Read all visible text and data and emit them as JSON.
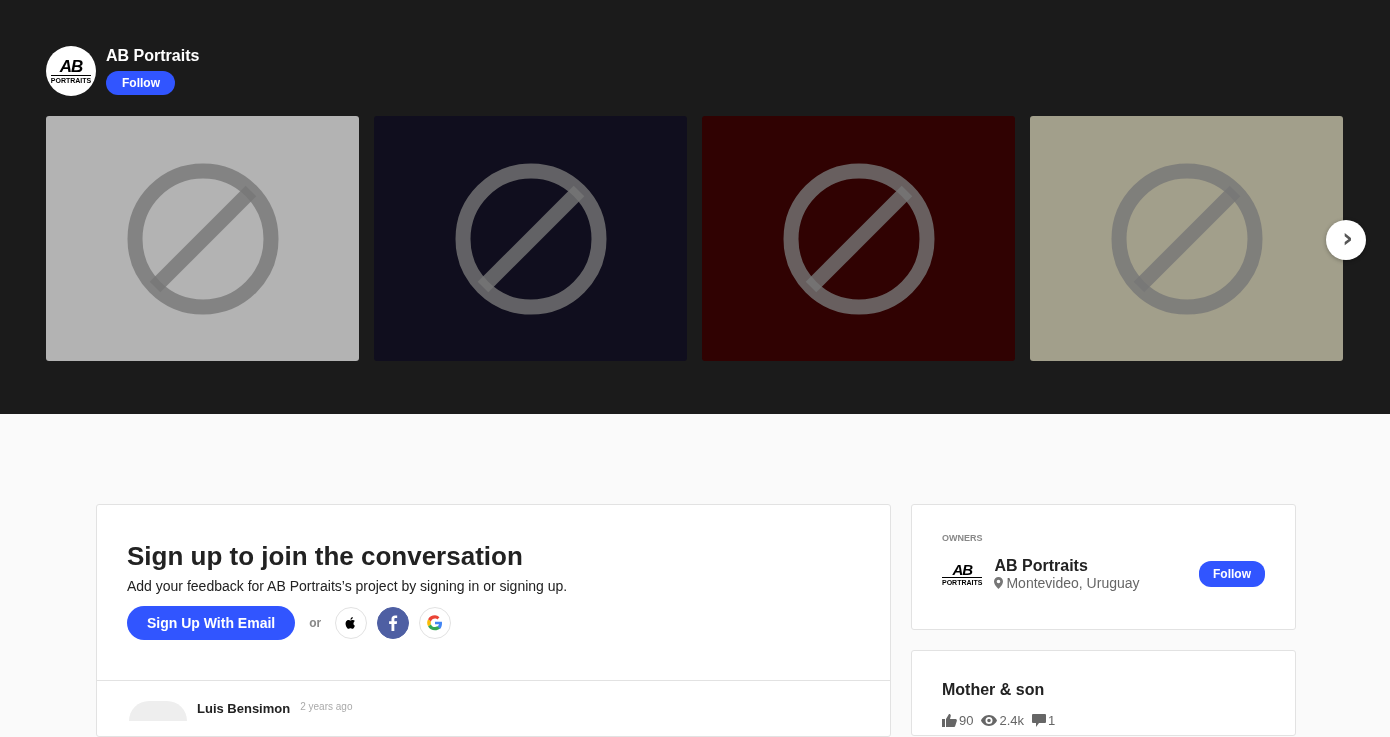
{
  "header": {
    "logo": {
      "mark": "AB",
      "caption": "PORTRAITS"
    },
    "name": "AB Portraits",
    "follow": "Follow"
  },
  "gallery": {
    "images": [
      {
        "color": "#b3b3b3"
      },
      {
        "color": "#100e1e"
      },
      {
        "color": "#300202"
      },
      {
        "color": "#a29f8b"
      }
    ],
    "next": "›"
  },
  "signup": {
    "title": "Sign up to join the conversation",
    "text": "Add your feedback for AB Portraits’s project by signing in or signing up.",
    "email_button": "Sign Up With Email",
    "or": "or"
  },
  "comment": {
    "author": "Luis Bensimon",
    "time": "2 years ago"
  },
  "owners": {
    "heading": "OWNERS",
    "logo": {
      "mark": "AB",
      "caption": "PORTRAITS"
    },
    "name": "AB Portraits",
    "location": "Montevideo, Uruguay",
    "follow": "Follow"
  },
  "project": {
    "title": "Mother & son",
    "likes": "90",
    "views": "2.4k",
    "comments": "1"
  }
}
